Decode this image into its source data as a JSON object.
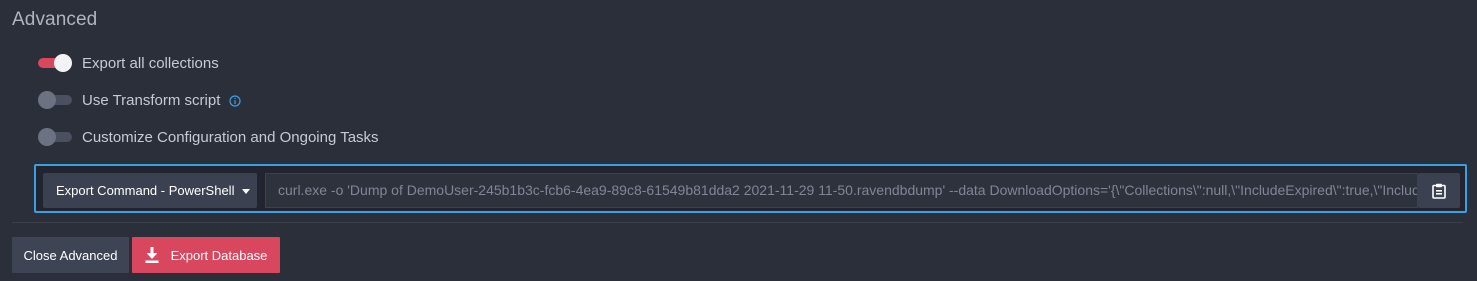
{
  "section": {
    "title": "Advanced"
  },
  "toggles": [
    {
      "label": "Export all collections",
      "checked": true
    },
    {
      "label": "Use Transform script",
      "checked": false,
      "icon": "info-icon"
    },
    {
      "label": "Customize Configuration and Ongoing Tasks",
      "checked": false
    }
  ],
  "command": {
    "dropdown_label": "Export Command - PowerShell",
    "value": "curl.exe -o 'Dump of DemoUser-245b1b3c-fcb6-4ea9-89c8-61549b81dda2 2021-11-29 11-50.ravendbdump' --data DownloadOptions='{\\\"Collections\\\":null,\\\"IncludeExpired\\\":true,\\\"IncludeArtificial\\\":false}'",
    "copy_icon": "clipboard-icon"
  },
  "buttons": {
    "close_label": "Close Advanced",
    "export_label": "Export Database",
    "export_icon": "download-icon"
  },
  "colors": {
    "background": "#2b2f3a",
    "accent": "#d9475f",
    "focus_border": "#3aa0e4",
    "info": "#3aa0e4"
  }
}
